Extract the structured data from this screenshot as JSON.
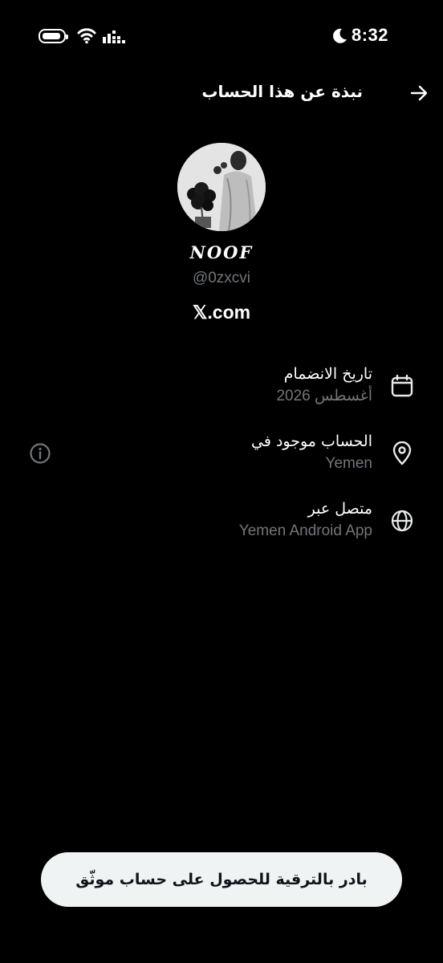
{
  "status_bar": {
    "time": "8:32",
    "icons": [
      "battery-icon",
      "wifi-icon",
      "signal-icon",
      "moon-icon"
    ]
  },
  "header": {
    "title": "نبذة عن هذا الحساب",
    "back_icon": "arrow-right-icon"
  },
  "profile": {
    "display_name": "𝑵𝑶𝑶𝑭",
    "handle": "@0zxcvi",
    "domain": "𝕏.com"
  },
  "info": {
    "joined": {
      "label": "تاريخ الانضمام",
      "value": "أغسطس 2026",
      "icon": "calendar-icon"
    },
    "location": {
      "label": "الحساب موجود في",
      "value": "Yemen",
      "icon": "location-pin-icon"
    },
    "connected": {
      "label": "متصل عبر",
      "value": "Yemen Android App",
      "icon": "globe-icon"
    }
  },
  "upgrade_button": {
    "label": "بادر بالترقية للحصول على حساب موثّق"
  },
  "colors": {
    "background": "#000000",
    "primary_text": "#e7e9ea",
    "secondary_text": "#71767b",
    "button_bg": "#eff3f4"
  }
}
